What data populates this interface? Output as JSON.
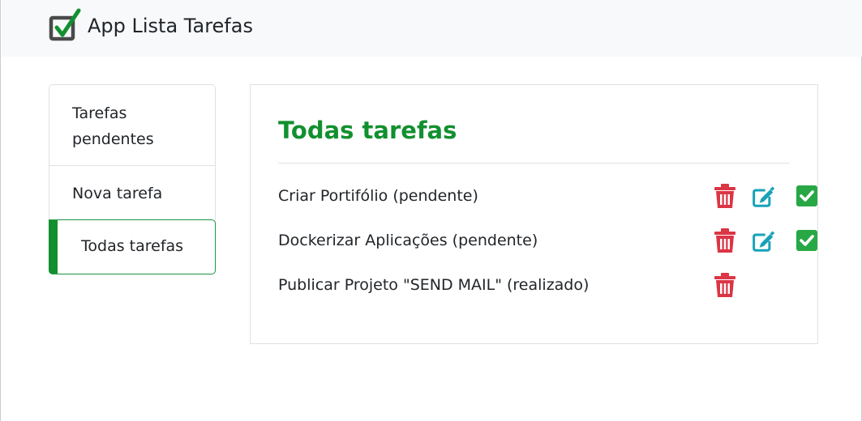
{
  "app": {
    "title": "App Lista Tarefas"
  },
  "sidebar": {
    "items": [
      {
        "label": "Tarefas pendentes"
      },
      {
        "label": "Nova tarefa"
      },
      {
        "label": "Todas tarefas"
      }
    ]
  },
  "main": {
    "title": "Todas tarefas",
    "tasks": [
      {
        "text": "Criar Portifólio (pendente)",
        "status": "pendente",
        "actions": [
          "trash-icon",
          "edit-icon",
          "check-icon"
        ]
      },
      {
        "text": "Dockerizar Aplicações (pendente)",
        "status": "pendente",
        "actions": [
          "trash-icon",
          "edit-icon",
          "check-icon"
        ]
      },
      {
        "text": "Publicar Projeto \"SEND MAIL\" (realizado)",
        "status": "realizado",
        "actions": [
          "trash-icon"
        ]
      }
    ]
  },
  "colors": {
    "accent": "#12902f",
    "danger": "#dc3545",
    "info": "#17a2b8",
    "success": "#28a745"
  }
}
